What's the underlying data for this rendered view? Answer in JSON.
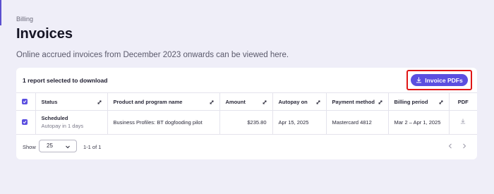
{
  "header": {
    "breadcrumb": "Billing",
    "title": "Invoices",
    "subtitle": "Online accrued invoices from December 2023 onwards can be viewed here."
  },
  "toolbar": {
    "selected_text": "1 report selected to download",
    "download_button": "Invoice PDFs"
  },
  "table": {
    "columns": [
      "Status",
      "Product and program name",
      "Amount",
      "Autopay on",
      "Payment method",
      "Billing period",
      "PDF"
    ],
    "rows": [
      {
        "checked": true,
        "status": "Scheduled",
        "status_sub": "Autopay in 1 days",
        "product": "Business Profiles: BT dogfooding pilot",
        "amount": "$235.80",
        "autopay_on": "Apr 15, 2025",
        "payment_method": "Mastercard 4812",
        "billing_period": "Mar 2 – Apr 1, 2025"
      }
    ]
  },
  "footer": {
    "show_label": "Show",
    "page_size": "25",
    "range": "1-1 of 1"
  },
  "colors": {
    "accent": "#5b4fe0",
    "highlight": "#e01616",
    "background": "#efeef8"
  },
  "icons": [
    "download-icon",
    "sort-icon",
    "checkbox-icon",
    "chevron-down-icon",
    "chevron-left-icon",
    "chevron-right-icon"
  ]
}
